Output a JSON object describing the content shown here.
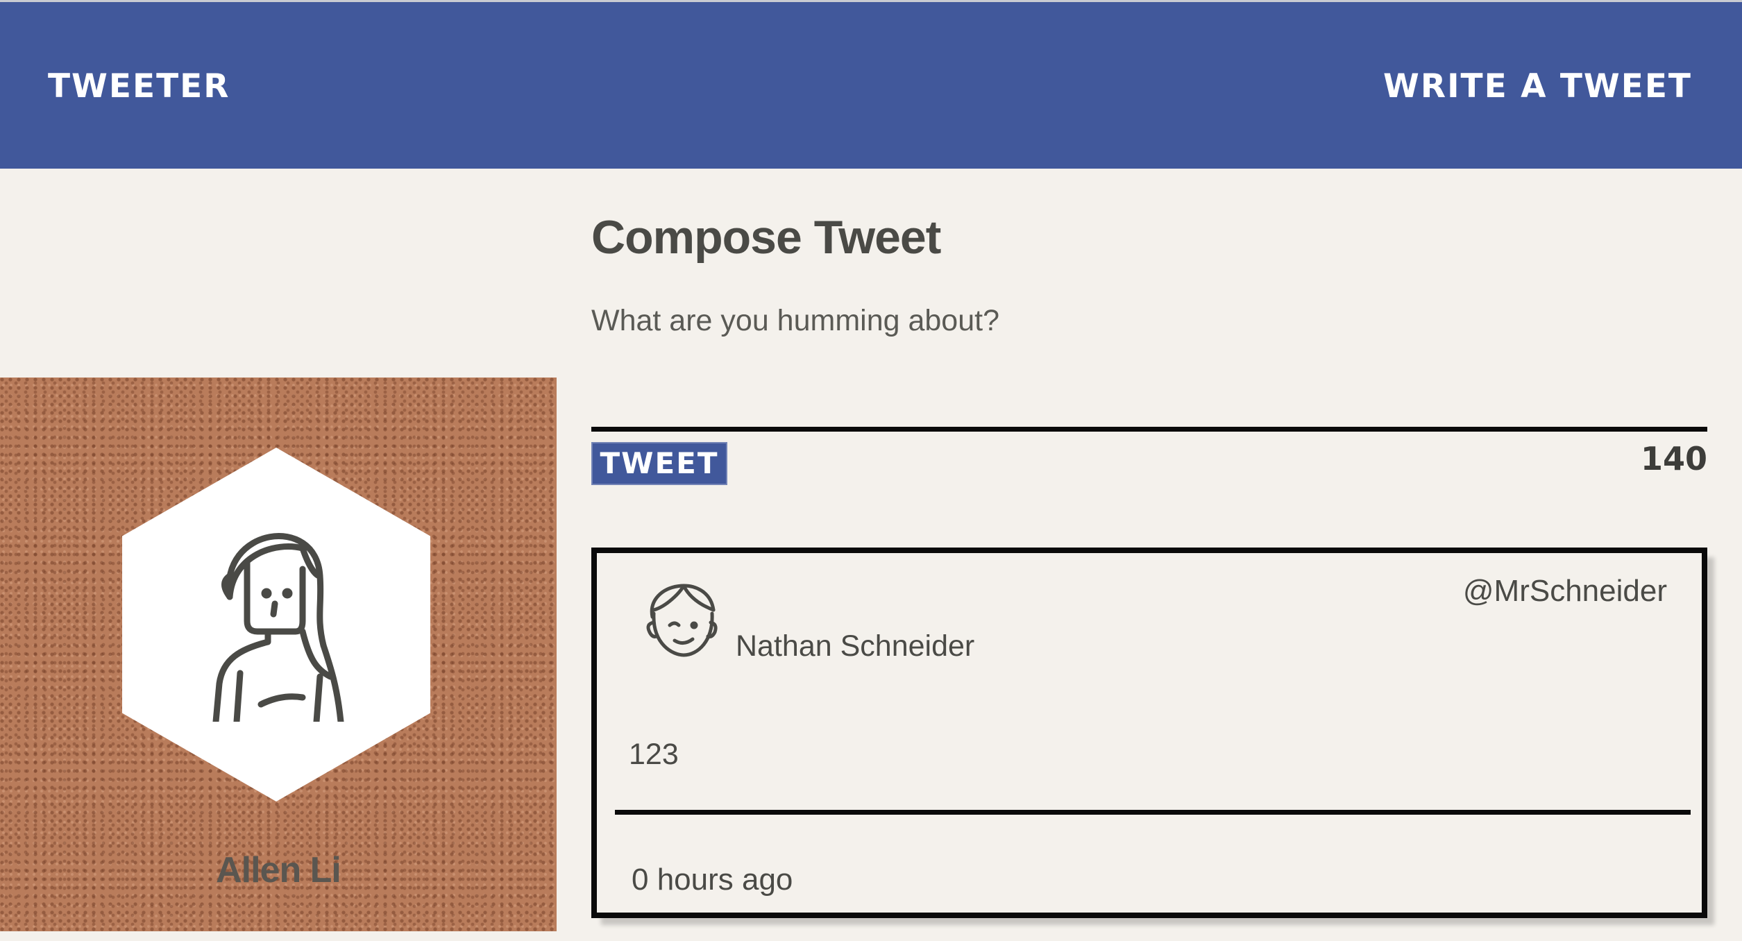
{
  "nav": {
    "brand": "TWEETER",
    "write_link": "WRITE A TWEET"
  },
  "profile": {
    "name": "Allen Li",
    "avatar_icon": "female-avatar-icon",
    "background_color": "#b97c5b"
  },
  "compose": {
    "title": "Compose Tweet",
    "placeholder": "What are you humming about?",
    "tweet_button": "TWEET",
    "char_counter": "140"
  },
  "tweets": [
    {
      "author_name": "Nathan Schneider",
      "handle": "@MrSchneider",
      "avatar_icon": "male-avatar-icon",
      "body": "123",
      "time_ago": "0 hours ago"
    }
  ],
  "colors": {
    "nav_background": "#41589b",
    "page_background": "#f4f1ec",
    "text": "#4a4a46"
  }
}
